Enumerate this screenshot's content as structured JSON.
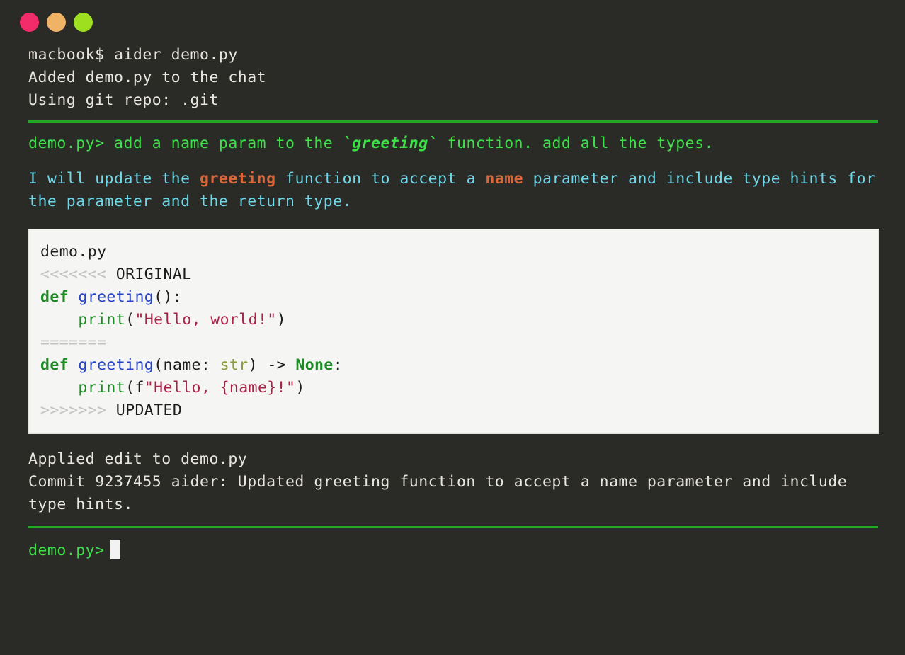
{
  "window": {
    "controls": [
      {
        "name": "close",
        "color": "#f22b6b"
      },
      {
        "name": "minimize",
        "color": "#f0b265"
      },
      {
        "name": "maximize",
        "color": "#9ee020"
      }
    ]
  },
  "colors": {
    "background": "#2a2b26",
    "system_text": "#e8e6df",
    "prompt_green": "#3fe14a",
    "rule_green": "#22a722",
    "assistant_cyan": "#6fd7e8",
    "highlight_orange": "#d9653a",
    "code_background": "#f5f6f3"
  },
  "session": {
    "startup_lines": [
      "macbook$ aider demo.py",
      "Added demo.py to the chat",
      "Using git repo: .git"
    ],
    "user_prompt": {
      "prefix": "demo.py> ",
      "before": "add a name param to the ",
      "highlight": "`greeting`",
      "after": " function. add all the types."
    },
    "assistant_reply": {
      "seg1": "I will update the ",
      "code1": "greeting",
      "seg2": " function to accept a ",
      "code2": "name",
      "seg3": " parameter and include type hints for the parameter and the return type."
    },
    "code_block": {
      "filename": "demo.py",
      "conflict_start": "<<<<<<<",
      "conflict_start_label": " ORIGINAL",
      "original": {
        "def_kw": "def ",
        "fn_name": "greeting",
        "signature": "():",
        "body_indent": "    ",
        "print_fn": "print",
        "print_open": "(",
        "string": "\"Hello, world!\"",
        "print_close": ")"
      },
      "conflict_divider": "=======",
      "updated": {
        "def_kw": "def ",
        "fn_name": "greeting",
        "sig_open": "(name: ",
        "type_hint": "str",
        "sig_mid": ") -> ",
        "return_type": "None",
        "sig_close": ":",
        "body_indent": "    ",
        "print_fn": "print",
        "print_open": "(f",
        "string": "\"Hello, {name}!\"",
        "print_close": ")"
      },
      "conflict_end": ">>>>>>>",
      "conflict_end_label": " UPDATED"
    },
    "result_lines": [
      "Applied edit to demo.py",
      "Commit 9237455 aider: Updated greeting function to accept a name parameter and include type hints."
    ],
    "final_prompt": "demo.py>"
  }
}
